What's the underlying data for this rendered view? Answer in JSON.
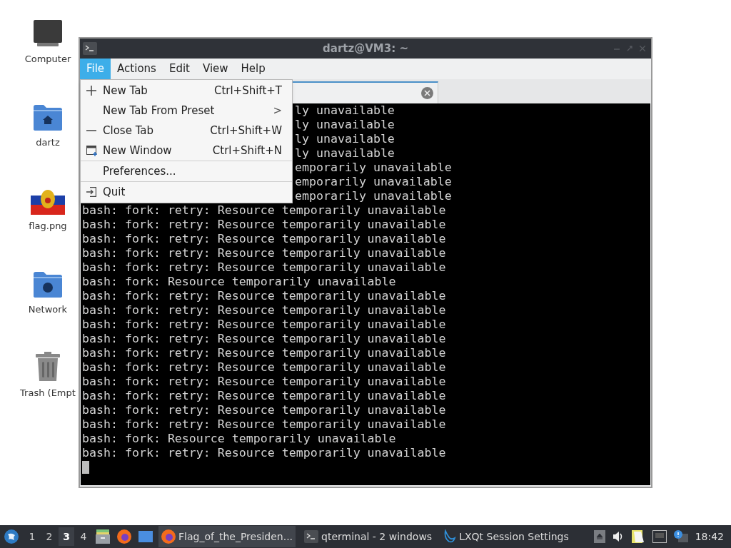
{
  "desktop_icons": [
    {
      "label": "Computer",
      "kind": "computer"
    },
    {
      "label": "dartz",
      "kind": "home"
    },
    {
      "label": "flag.png",
      "kind": "picture"
    },
    {
      "label": "Network",
      "kind": "network"
    },
    {
      "label": "Trash (Empt",
      "kind": "trash"
    }
  ],
  "window": {
    "title": "dartz@VM3: ~",
    "menu": [
      {
        "label": "File",
        "selected": true
      },
      {
        "label": "Actions",
        "selected": false
      },
      {
        "label": "Edit",
        "selected": false
      },
      {
        "label": "View",
        "selected": false
      },
      {
        "label": "Help",
        "selected": false
      }
    ],
    "file_menu": [
      {
        "kind": "add",
        "label": "New Tab",
        "shortcut": "Ctrl+Shift+T"
      },
      {
        "kind": "submenu",
        "label": "New Tab From Preset",
        "arrow": ">"
      },
      {
        "kind": "remove",
        "label": "Close Tab",
        "shortcut": "Ctrl+Shift+W"
      },
      {
        "kind": "window",
        "label": "New Window",
        "shortcut": "Ctrl+Shift+N"
      },
      {
        "kind": "separator"
      },
      {
        "kind": "plain",
        "label": "Preferences..."
      },
      {
        "kind": "separator"
      },
      {
        "kind": "quit",
        "label": "Quit"
      }
    ],
    "terminal": {
      "lines": [
        {
          "kind": "partial",
          "text": "ly unavailable"
        },
        {
          "kind": "partial",
          "text": "ly unavailable"
        },
        {
          "kind": "partial",
          "text": "ly unavailable"
        },
        {
          "kind": "partial",
          "text": "ly unavailable"
        },
        {
          "kind": "partial",
          "text": "emporarily unavailable"
        },
        {
          "kind": "partial",
          "text": "emporarily unavailable"
        },
        {
          "kind": "partial",
          "text": "emporarily unavailable"
        },
        {
          "kind": "full",
          "text": "bash: fork: retry: Resource temporarily unavailable"
        },
        {
          "kind": "full",
          "text": "bash: fork: retry: Resource temporarily unavailable"
        },
        {
          "kind": "full",
          "text": "bash: fork: retry: Resource temporarily unavailable"
        },
        {
          "kind": "full",
          "text": "bash: fork: retry: Resource temporarily unavailable"
        },
        {
          "kind": "full",
          "text": "bash: fork: retry: Resource temporarily unavailable"
        },
        {
          "kind": "full",
          "text": "bash: fork: Resource temporarily unavailable"
        },
        {
          "kind": "full",
          "text": "bash: fork: retry: Resource temporarily unavailable"
        },
        {
          "kind": "full",
          "text": "bash: fork: retry: Resource temporarily unavailable"
        },
        {
          "kind": "full",
          "text": "bash: fork: retry: Resource temporarily unavailable"
        },
        {
          "kind": "full",
          "text": "bash: fork: retry: Resource temporarily unavailable"
        },
        {
          "kind": "full",
          "text": "bash: fork: retry: Resource temporarily unavailable"
        },
        {
          "kind": "full",
          "text": "bash: fork: retry: Resource temporarily unavailable"
        },
        {
          "kind": "full",
          "text": "bash: fork: retry: Resource temporarily unavailable"
        },
        {
          "kind": "full",
          "text": "bash: fork: retry: Resource temporarily unavailable"
        },
        {
          "kind": "full",
          "text": "bash: fork: retry: Resource temporarily unavailable"
        },
        {
          "kind": "full",
          "text": "bash: fork: retry: Resource temporarily unavailable"
        },
        {
          "kind": "full",
          "text": "bash: fork: Resource temporarily unavailable"
        },
        {
          "kind": "full",
          "text": "bash: fork: retry: Resource temporarily unavailable"
        }
      ]
    }
  },
  "taskbar": {
    "desktops": [
      {
        "label": "1",
        "selected": false
      },
      {
        "label": "2",
        "selected": false
      },
      {
        "label": "3",
        "selected": true
      },
      {
        "label": "4",
        "selected": false
      }
    ],
    "tasks": [
      {
        "kind": "browser",
        "label": "Flag_of_the_Presiden...",
        "selected": true
      },
      {
        "kind": "terminal",
        "label": "qterminal - 2 windows",
        "selected": false
      },
      {
        "kind": "settings",
        "label": "LXQt Session Settings",
        "selected": false
      }
    ],
    "clock": "18:42"
  }
}
